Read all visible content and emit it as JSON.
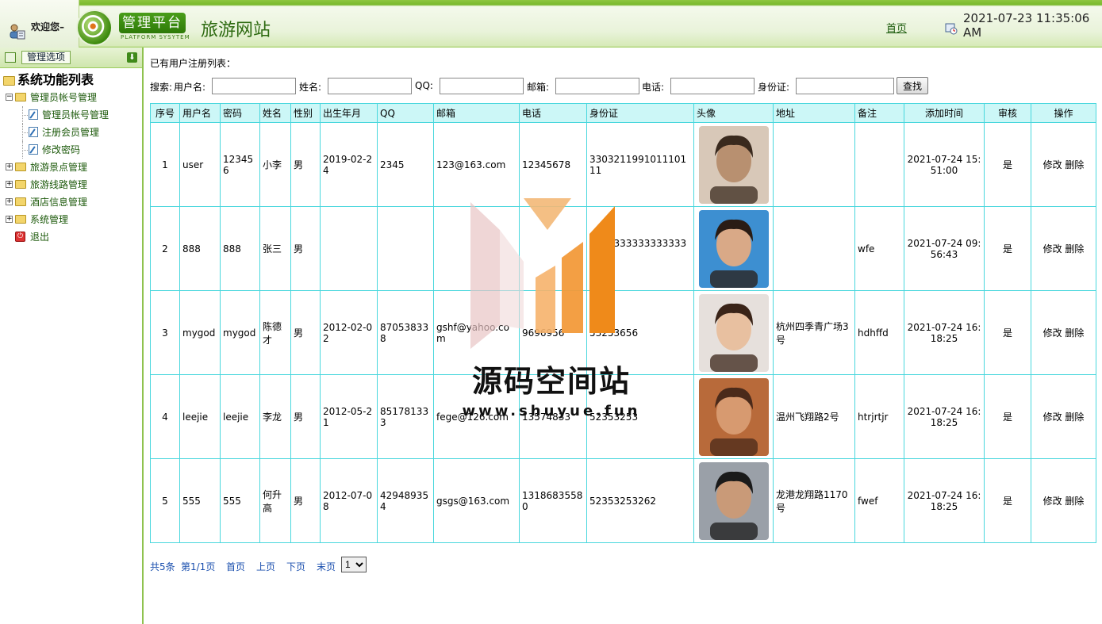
{
  "header": {
    "welcome": "欢迎您–",
    "logo_text": "管理平台",
    "logo_sub": "PLATFORM SYSYTEM",
    "site_title": "旅游网站",
    "home_link": "首页",
    "datetime": "2021-07-23 11:35:06 AM"
  },
  "sidebar": {
    "header_label": "管理选项",
    "tree_title": "系统功能列表",
    "items": [
      {
        "label": "管理员帐号管理",
        "level": 1,
        "expanded": true
      },
      {
        "label": "管理员帐号管理",
        "level": 2
      },
      {
        "label": "注册会员管理",
        "level": 2
      },
      {
        "label": "修改密码",
        "level": 2
      },
      {
        "label": "旅游景点管理",
        "level": 1,
        "expanded": false
      },
      {
        "label": "旅游线路管理",
        "level": 1,
        "expanded": false
      },
      {
        "label": "酒店信息管理",
        "level": 1,
        "expanded": false
      },
      {
        "label": "系统管理",
        "level": 1,
        "expanded": false
      },
      {
        "label": "退出",
        "level": 1,
        "exit": true
      }
    ]
  },
  "main": {
    "caption": "已有用户注册列表：",
    "search": {
      "prefix": "搜索:",
      "username_label": "用户名:",
      "name_label": "姓名:",
      "qq_label": "QQ:",
      "email_label": "邮箱:",
      "phone_label": "电话:",
      "idcard_label": "身份证:",
      "button": "查找"
    },
    "table": {
      "headers": [
        "序号",
        "用户名",
        "密码",
        "姓名",
        "性别",
        "出生年月",
        "QQ",
        "邮箱",
        "电话",
        "身份证",
        "头像",
        "地址",
        "备注",
        "添加时间",
        "审核",
        "操作"
      ],
      "rows": [
        {
          "no": "1",
          "username": "user",
          "password": "123456",
          "name": "小李",
          "gender": "男",
          "birth": "2019-02-24",
          "qq": "2345",
          "email": "123@163.com",
          "phone": "12345678",
          "idcard": "330321199101110111",
          "address": "",
          "remark": "",
          "added": "2021-07-24 15:51:00",
          "audit": "是",
          "edit": "修改",
          "delete": "删除"
        },
        {
          "no": "2",
          "username": "888",
          "password": "888",
          "name": "张三",
          "gender": "男",
          "birth": "",
          "qq": "",
          "email": "",
          "phone": "",
          "idcard": "333333333333333333",
          "address": "",
          "remark": "wfe",
          "added": "2021-07-24 09:56:43",
          "audit": "是",
          "edit": "修改",
          "delete": "删除"
        },
        {
          "no": "3",
          "username": "mygod",
          "password": "mygod",
          "name": "陈德才",
          "gender": "男",
          "birth": "2012-02-02",
          "qq": "870538338",
          "email": "gshf@yahoo.com",
          "phone": "9696956",
          "idcard": "53253656",
          "address": "杭州四季青广场3号",
          "remark": "hdhffd",
          "added": "2021-07-24 16:18:25",
          "audit": "是",
          "edit": "修改",
          "delete": "删除"
        },
        {
          "no": "4",
          "username": "leejie",
          "password": "leejie",
          "name": "李龙",
          "gender": "男",
          "birth": "2012-05-21",
          "qq": "851781333",
          "email": "fege@126.com",
          "phone": "13574833",
          "idcard": "52353253",
          "address": "温州飞翔路2号",
          "remark": "htrjrtjr",
          "added": "2021-07-24 16:18:25",
          "audit": "是",
          "edit": "修改",
          "delete": "删除"
        },
        {
          "no": "5",
          "username": "555",
          "password": "555",
          "name": "何升高",
          "gender": "男",
          "birth": "2012-07-08",
          "qq": "429489354",
          "email": "gsgs@163.com",
          "phone": "13186835580",
          "idcard": "52353253262",
          "address": "龙港龙翔路1170号",
          "remark": "fwef",
          "added": "2021-07-24 16:18:25",
          "audit": "是",
          "edit": "修改",
          "delete": "删除"
        }
      ]
    },
    "pager": {
      "total": "共5条",
      "page_info": "第1/1页",
      "first": "首页",
      "prev": "上页",
      "next": "下页",
      "last": "末页",
      "page_select": "1"
    }
  },
  "watermark": {
    "text": "源码空间站",
    "url": "www.shuyue.fun"
  },
  "colors": {
    "header_green": "#7ab82d",
    "table_border": "#49d7dd",
    "table_header_bg": "#ccf7f7",
    "link_blue": "#1a4fae",
    "tree_text": "#1d5a0b"
  }
}
